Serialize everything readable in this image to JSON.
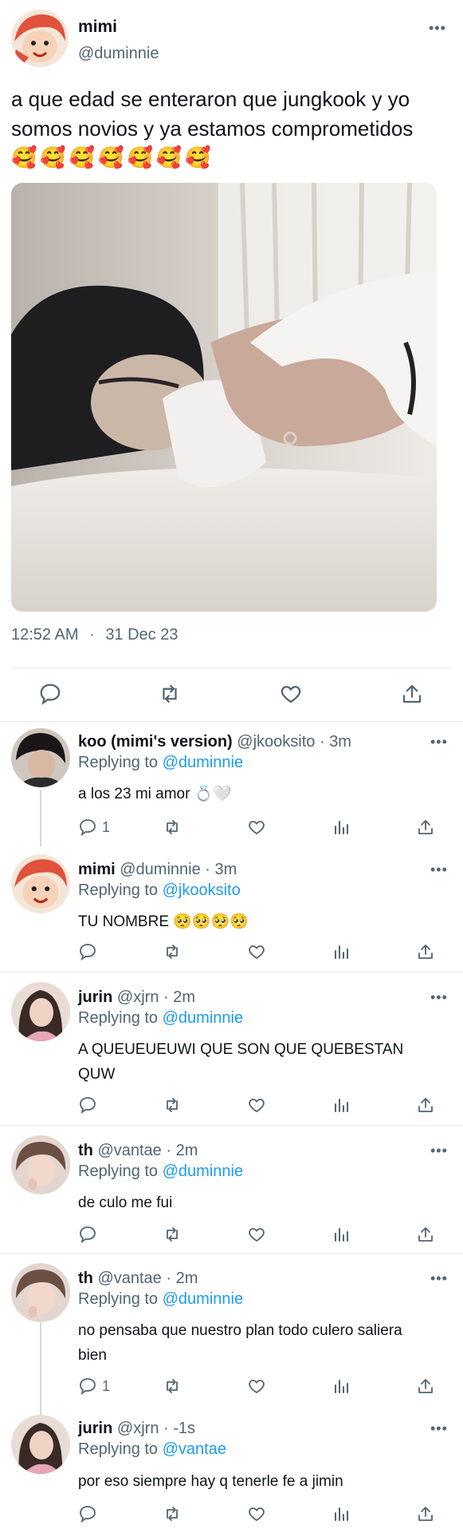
{
  "main_tweet": {
    "name": "mimi",
    "handle": "@duminnie",
    "text": "a que edad se enteraron que jungkook y yo somos novios y ya estamos comprometidos",
    "emojis": [
      "🥰",
      "🥰",
      "🥰",
      "🥰",
      "🥰",
      "🥰",
      "🥰"
    ],
    "time": "12:52 AM",
    "separator": "·",
    "date": "31 Dec 23",
    "more": "•••",
    "avatar_icon": "ponyo-avatar",
    "actions": [
      "reply-icon",
      "retweet-icon",
      "like-icon",
      "share-icon"
    ]
  },
  "replies": [
    {
      "name": "koo (mimi's version)",
      "handle": "@jkooksito",
      "time_sep": "·",
      "time": "3m",
      "replying_label": "Replying to",
      "replying_to": "@duminnie",
      "text": "a los 23 mi amor 💍🤍",
      "reply_count": "1",
      "more": "•••",
      "avatar_icon": "dark-hair-avatar"
    },
    {
      "name": "mimi",
      "handle": "@duminnie",
      "time_sep": "·",
      "time": "3m",
      "replying_label": "Replying to",
      "replying_to": "@jkooksito",
      "text": "TU NOMBRE 🥺🥺🥺🥺",
      "reply_count": "",
      "more": "•••",
      "avatar_icon": "ponyo-avatar"
    },
    {
      "name": "jurin",
      "handle": "@xjrn",
      "time_sep": "·",
      "time": "2m",
      "replying_label": "Replying to",
      "replying_to": "@duminnie",
      "text": "A QUEUEUEUWI QUE SON QUE QUEBESTAN QUW",
      "reply_count": "",
      "more": "•••",
      "avatar_icon": "girl-avatar"
    },
    {
      "name": "th",
      "handle": "@vantae",
      "time_sep": "·",
      "time": "2m",
      "replying_label": "Replying to",
      "replying_to": "@duminnie",
      "text": "de culo me fui",
      "reply_count": "",
      "more": "•••",
      "avatar_icon": "boy-avatar"
    },
    {
      "name": "th",
      "handle": "@vantae",
      "time_sep": "·",
      "time": "2m",
      "replying_label": "Replying to",
      "replying_to": "@duminnie",
      "text": "no pensaba que nuestro plan todo culero saliera bien",
      "reply_count": "1",
      "more": "•••",
      "avatar_icon": "boy-avatar"
    },
    {
      "name": "jurin",
      "handle": "@xjrn",
      "time_sep": "·",
      "time": "-1s",
      "replying_label": "Replying to",
      "replying_to": "@vantae",
      "text": "por eso siempre hay q tenerle fe a jimin",
      "reply_count": "",
      "more": "•••",
      "avatar_icon": "girl-avatar"
    }
  ],
  "colors": {
    "link": "#1d9bf0",
    "muted": "#536471",
    "text": "#0f1419",
    "divider": "#e6e9ec"
  }
}
